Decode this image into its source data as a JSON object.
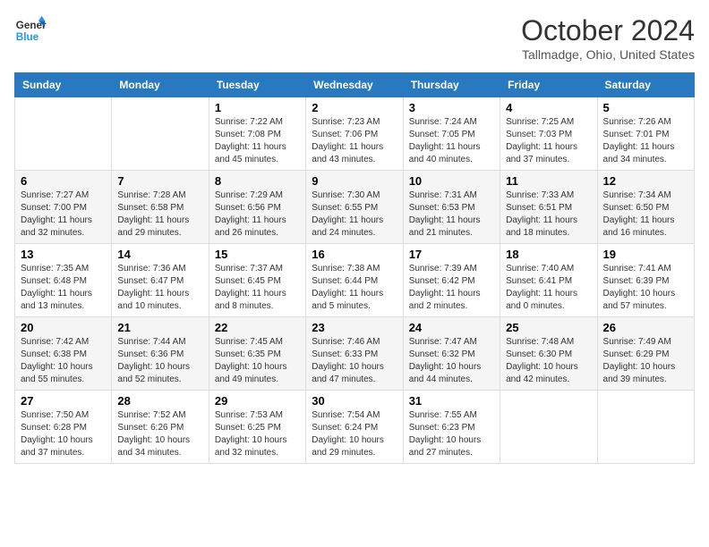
{
  "logo": {
    "line1": "General",
    "line2": "Blue"
  },
  "title": "October 2024",
  "subtitle": "Tallmadge, Ohio, United States",
  "days_of_week": [
    "Sunday",
    "Monday",
    "Tuesday",
    "Wednesday",
    "Thursday",
    "Friday",
    "Saturday"
  ],
  "weeks": [
    [
      {
        "day": "",
        "sunrise": "",
        "sunset": "",
        "daylight": ""
      },
      {
        "day": "",
        "sunrise": "",
        "sunset": "",
        "daylight": ""
      },
      {
        "day": "1",
        "sunrise": "Sunrise: 7:22 AM",
        "sunset": "Sunset: 7:08 PM",
        "daylight": "Daylight: 11 hours and 45 minutes."
      },
      {
        "day": "2",
        "sunrise": "Sunrise: 7:23 AM",
        "sunset": "Sunset: 7:06 PM",
        "daylight": "Daylight: 11 hours and 43 minutes."
      },
      {
        "day": "3",
        "sunrise": "Sunrise: 7:24 AM",
        "sunset": "Sunset: 7:05 PM",
        "daylight": "Daylight: 11 hours and 40 minutes."
      },
      {
        "day": "4",
        "sunrise": "Sunrise: 7:25 AM",
        "sunset": "Sunset: 7:03 PM",
        "daylight": "Daylight: 11 hours and 37 minutes."
      },
      {
        "day": "5",
        "sunrise": "Sunrise: 7:26 AM",
        "sunset": "Sunset: 7:01 PM",
        "daylight": "Daylight: 11 hours and 34 minutes."
      }
    ],
    [
      {
        "day": "6",
        "sunrise": "Sunrise: 7:27 AM",
        "sunset": "Sunset: 7:00 PM",
        "daylight": "Daylight: 11 hours and 32 minutes."
      },
      {
        "day": "7",
        "sunrise": "Sunrise: 7:28 AM",
        "sunset": "Sunset: 6:58 PM",
        "daylight": "Daylight: 11 hours and 29 minutes."
      },
      {
        "day": "8",
        "sunrise": "Sunrise: 7:29 AM",
        "sunset": "Sunset: 6:56 PM",
        "daylight": "Daylight: 11 hours and 26 minutes."
      },
      {
        "day": "9",
        "sunrise": "Sunrise: 7:30 AM",
        "sunset": "Sunset: 6:55 PM",
        "daylight": "Daylight: 11 hours and 24 minutes."
      },
      {
        "day": "10",
        "sunrise": "Sunrise: 7:31 AM",
        "sunset": "Sunset: 6:53 PM",
        "daylight": "Daylight: 11 hours and 21 minutes."
      },
      {
        "day": "11",
        "sunrise": "Sunrise: 7:33 AM",
        "sunset": "Sunset: 6:51 PM",
        "daylight": "Daylight: 11 hours and 18 minutes."
      },
      {
        "day": "12",
        "sunrise": "Sunrise: 7:34 AM",
        "sunset": "Sunset: 6:50 PM",
        "daylight": "Daylight: 11 hours and 16 minutes."
      }
    ],
    [
      {
        "day": "13",
        "sunrise": "Sunrise: 7:35 AM",
        "sunset": "Sunset: 6:48 PM",
        "daylight": "Daylight: 11 hours and 13 minutes."
      },
      {
        "day": "14",
        "sunrise": "Sunrise: 7:36 AM",
        "sunset": "Sunset: 6:47 PM",
        "daylight": "Daylight: 11 hours and 10 minutes."
      },
      {
        "day": "15",
        "sunrise": "Sunrise: 7:37 AM",
        "sunset": "Sunset: 6:45 PM",
        "daylight": "Daylight: 11 hours and 8 minutes."
      },
      {
        "day": "16",
        "sunrise": "Sunrise: 7:38 AM",
        "sunset": "Sunset: 6:44 PM",
        "daylight": "Daylight: 11 hours and 5 minutes."
      },
      {
        "day": "17",
        "sunrise": "Sunrise: 7:39 AM",
        "sunset": "Sunset: 6:42 PM",
        "daylight": "Daylight: 11 hours and 2 minutes."
      },
      {
        "day": "18",
        "sunrise": "Sunrise: 7:40 AM",
        "sunset": "Sunset: 6:41 PM",
        "daylight": "Daylight: 11 hours and 0 minutes."
      },
      {
        "day": "19",
        "sunrise": "Sunrise: 7:41 AM",
        "sunset": "Sunset: 6:39 PM",
        "daylight": "Daylight: 10 hours and 57 minutes."
      }
    ],
    [
      {
        "day": "20",
        "sunrise": "Sunrise: 7:42 AM",
        "sunset": "Sunset: 6:38 PM",
        "daylight": "Daylight: 10 hours and 55 minutes."
      },
      {
        "day": "21",
        "sunrise": "Sunrise: 7:44 AM",
        "sunset": "Sunset: 6:36 PM",
        "daylight": "Daylight: 10 hours and 52 minutes."
      },
      {
        "day": "22",
        "sunrise": "Sunrise: 7:45 AM",
        "sunset": "Sunset: 6:35 PM",
        "daylight": "Daylight: 10 hours and 49 minutes."
      },
      {
        "day": "23",
        "sunrise": "Sunrise: 7:46 AM",
        "sunset": "Sunset: 6:33 PM",
        "daylight": "Daylight: 10 hours and 47 minutes."
      },
      {
        "day": "24",
        "sunrise": "Sunrise: 7:47 AM",
        "sunset": "Sunset: 6:32 PM",
        "daylight": "Daylight: 10 hours and 44 minutes."
      },
      {
        "day": "25",
        "sunrise": "Sunrise: 7:48 AM",
        "sunset": "Sunset: 6:30 PM",
        "daylight": "Daylight: 10 hours and 42 minutes."
      },
      {
        "day": "26",
        "sunrise": "Sunrise: 7:49 AM",
        "sunset": "Sunset: 6:29 PM",
        "daylight": "Daylight: 10 hours and 39 minutes."
      }
    ],
    [
      {
        "day": "27",
        "sunrise": "Sunrise: 7:50 AM",
        "sunset": "Sunset: 6:28 PM",
        "daylight": "Daylight: 10 hours and 37 minutes."
      },
      {
        "day": "28",
        "sunrise": "Sunrise: 7:52 AM",
        "sunset": "Sunset: 6:26 PM",
        "daylight": "Daylight: 10 hours and 34 minutes."
      },
      {
        "day": "29",
        "sunrise": "Sunrise: 7:53 AM",
        "sunset": "Sunset: 6:25 PM",
        "daylight": "Daylight: 10 hours and 32 minutes."
      },
      {
        "day": "30",
        "sunrise": "Sunrise: 7:54 AM",
        "sunset": "Sunset: 6:24 PM",
        "daylight": "Daylight: 10 hours and 29 minutes."
      },
      {
        "day": "31",
        "sunrise": "Sunrise: 7:55 AM",
        "sunset": "Sunset: 6:23 PM",
        "daylight": "Daylight: 10 hours and 27 minutes."
      },
      {
        "day": "",
        "sunrise": "",
        "sunset": "",
        "daylight": ""
      },
      {
        "day": "",
        "sunrise": "",
        "sunset": "",
        "daylight": ""
      }
    ]
  ]
}
